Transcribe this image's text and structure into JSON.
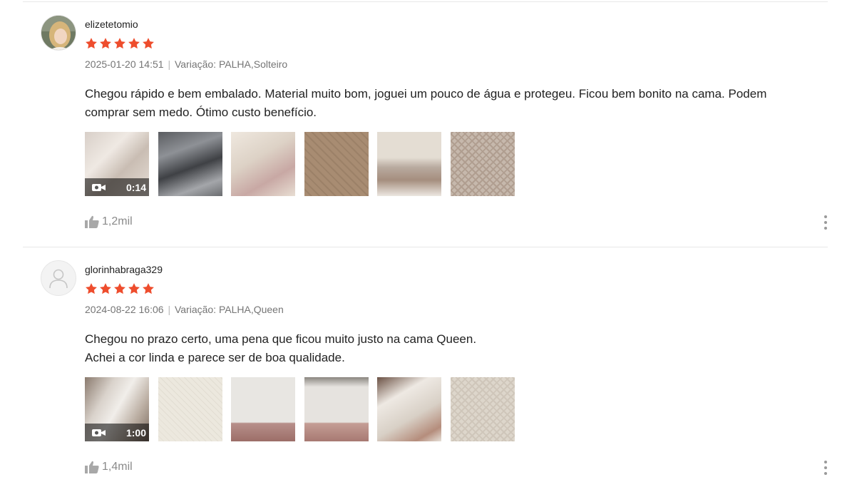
{
  "colors": {
    "star": "#ee4d2d",
    "text": "#222222",
    "meta": "#757575"
  },
  "reviews": [
    {
      "username": "elizetetomio",
      "rating": 5,
      "date": "2025-01-20 14:51",
      "variation": "Variação: PALHA,Solteiro",
      "text": "Chegou rápido e bem embalado. Material muito bom, joguei um pouco de água e protegeu. Ficou bem bonito na cama. Podem comprar sem medo. Ótimo custo benefício.",
      "video_duration": "0:14",
      "likes": "1,2mil",
      "avatar_icon": "user-photo-icon"
    },
    {
      "username": "glorinhabraga329",
      "rating": 5,
      "date": "2024-08-22 16:06",
      "variation": "Variação: PALHA,Queen",
      "text": "Chegou no prazo certo, uma pena que ficou muito justo na cama Queen.\nAchei a cor linda e parece ser de boa qualidade.",
      "video_duration": "1:00",
      "likes": "1,4mil",
      "avatar_icon": "default-user-icon"
    }
  ],
  "separator": "|"
}
